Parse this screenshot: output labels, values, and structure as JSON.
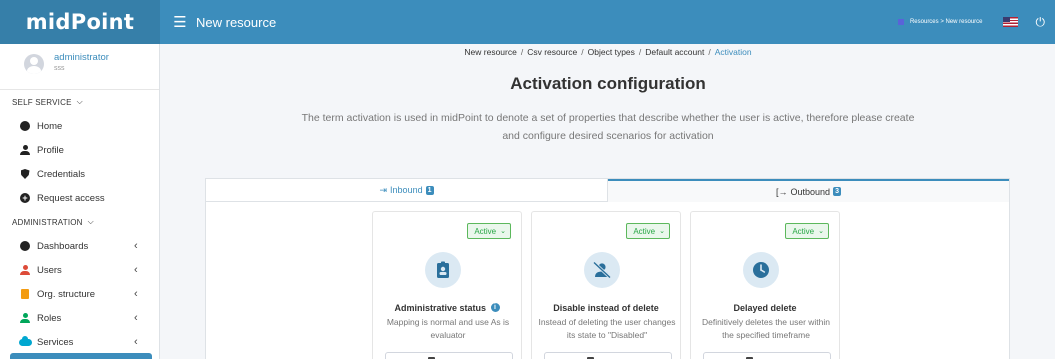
{
  "header": {
    "logo": "midPoint",
    "page_title": "New resource",
    "trail": "Resources > New resource",
    "colors": {
      "bar": "#3c8dbc",
      "logo_bg": "#367fa9"
    }
  },
  "user": {
    "name": "administrator",
    "subtitle": "sss"
  },
  "sidebar": {
    "self_service": {
      "label": "SELF SERVICE",
      "items": [
        {
          "label": "Home",
          "icon": "dashboard-icon"
        },
        {
          "label": "Profile",
          "icon": "user-icon"
        },
        {
          "label": "Credentials",
          "icon": "shield-icon"
        },
        {
          "label": "Request access",
          "icon": "plus-circle-icon"
        }
      ]
    },
    "administration": {
      "label": "ADMINISTRATION",
      "items": [
        {
          "label": "Dashboards",
          "icon": "dashboard-icon"
        },
        {
          "label": "Users",
          "icon": "user-icon"
        },
        {
          "label": "Org. structure",
          "icon": "building-icon"
        },
        {
          "label": "Roles",
          "icon": "roles-icon"
        },
        {
          "label": "Services",
          "icon": "cloud-icon"
        }
      ]
    }
  },
  "breadcrumb": [
    "New resource",
    "Csv resource",
    "Object types",
    "Default account",
    "Activation"
  ],
  "main": {
    "title": "Activation configuration",
    "description": "The term activation is used in midPoint to denote a set of properties that describe whether the user is active, therefore please create and configure desired scenarios for activation"
  },
  "tabs": [
    {
      "label": "Inbound",
      "count": "1",
      "icon": "sign-in-icon"
    },
    {
      "label": "Outbound",
      "count": "3",
      "icon": "sign-out-icon"
    }
  ],
  "cards": [
    {
      "status": "Active",
      "title": "Administrative status",
      "description": "Mapping is normal and use As is evaluator",
      "icon": "id-badge-icon"
    },
    {
      "status": "Active",
      "title": "Disable instead of delete",
      "description": "Instead of deleting the user changes its state to \"Disabled\"",
      "icon": "user-slash-icon"
    },
    {
      "status": "Active",
      "title": "Delayed delete",
      "description": "Definitively deletes the user within the specified timeframe",
      "icon": "clock-icon"
    }
  ]
}
